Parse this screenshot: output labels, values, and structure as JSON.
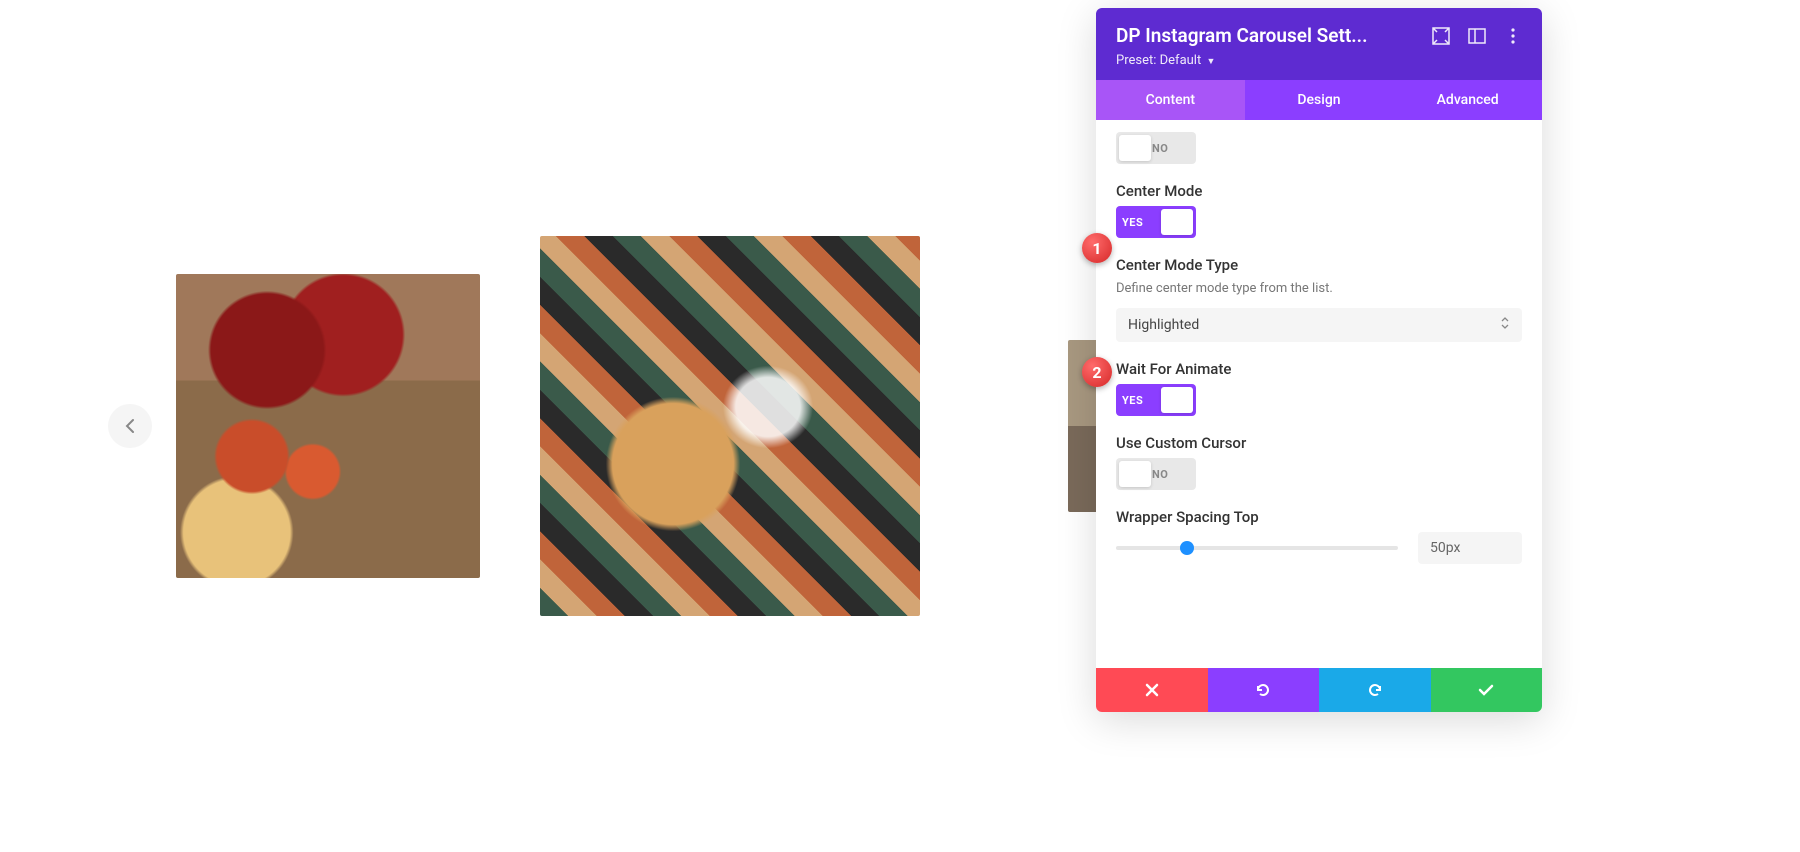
{
  "panel": {
    "title": "DP Instagram Carousel Sett...",
    "preset_label": "Preset:",
    "preset_value": "Default"
  },
  "tabs": {
    "content": "Content",
    "design": "Design",
    "advanced": "Advanced",
    "active": "content"
  },
  "fields": {
    "top_toggle": {
      "state": "off",
      "no": "NO"
    },
    "center_mode": {
      "label": "Center Mode",
      "state": "on",
      "yes": "YES"
    },
    "center_mode_type": {
      "label": "Center Mode Type",
      "desc": "Define center mode type from the list.",
      "value": "Highlighted"
    },
    "wait_animate": {
      "label": "Wait For Animate",
      "state": "on",
      "yes": "YES"
    },
    "custom_cursor": {
      "label": "Use Custom Cursor",
      "state": "off",
      "no": "NO"
    },
    "wrapper_spacing": {
      "label": "Wrapper Spacing Top",
      "value": "50px",
      "percent": 25
    }
  },
  "badges": {
    "one": "1",
    "two": "2"
  },
  "icons": {
    "expand": "expand",
    "columns": "columns",
    "more": "more"
  }
}
